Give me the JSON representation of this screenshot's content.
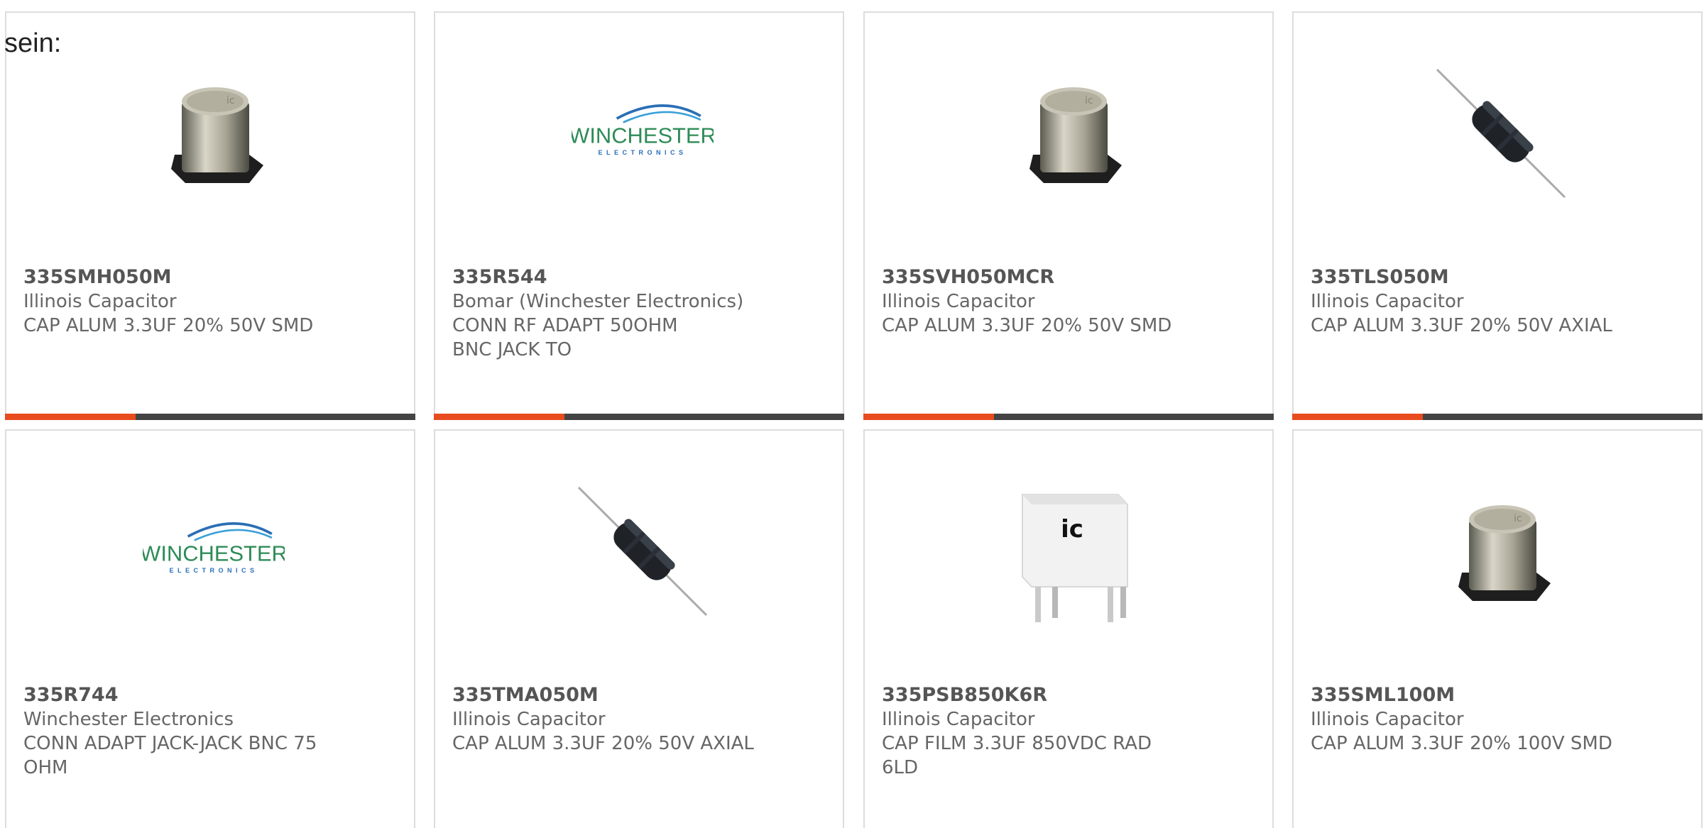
{
  "intro_text": "sein:",
  "brand_colors": {
    "accent": "#e84c1e",
    "bar": "#444444",
    "winchester_green": "#2e8b57",
    "winchester_blue": "#2a6fb5"
  },
  "products": [
    {
      "part_number": "335SMH050M",
      "manufacturer": "Illinois Capacitor",
      "description": "CAP ALUM 3.3UF 20% 50V SMD",
      "image": "smd-electrolytic-capacitor"
    },
    {
      "part_number": "335R544",
      "manufacturer": "Bomar (Winchester Electronics)",
      "description": "CONN RF ADAPT 50OHM BNC JACK TO",
      "image": "winchester-electronics-logo",
      "logo_text": "WINCHESTER",
      "logo_subtext": "ELECTRONICS"
    },
    {
      "part_number": "335SVH050MCR",
      "manufacturer": "Illinois Capacitor",
      "description": "CAP ALUM 3.3UF 20% 50V SMD",
      "image": "smd-electrolytic-capacitor"
    },
    {
      "part_number": "335TLS050M",
      "manufacturer": "Illinois Capacitor",
      "description": "CAP ALUM 3.3UF 20% 50V AXIAL",
      "image": "axial-electrolytic-capacitor"
    },
    {
      "part_number": "335R744",
      "manufacturer": "Winchester Electronics",
      "description": "CONN ADAPT JACK-JACK BNC 75 OHM",
      "image": "winchester-electronics-logo",
      "logo_text": "WINCHESTER",
      "logo_subtext": "ELECTRONICS"
    },
    {
      "part_number": "335TMA050M",
      "manufacturer": "Illinois Capacitor",
      "description": "CAP ALUM 3.3UF 20% 50V AXIAL",
      "image": "axial-electrolytic-capacitor"
    },
    {
      "part_number": "335PSB850K6R",
      "manufacturer": "Illinois Capacitor",
      "description": "CAP FILM 3.3UF 850VDC RAD 6LD",
      "image": "film-capacitor",
      "logo_text": "ic"
    },
    {
      "part_number": "335SML100M",
      "manufacturer": "Illinois Capacitor",
      "description": "CAP ALUM 3.3UF 20% 100V SMD",
      "image": "smd-electrolytic-capacitor"
    }
  ]
}
